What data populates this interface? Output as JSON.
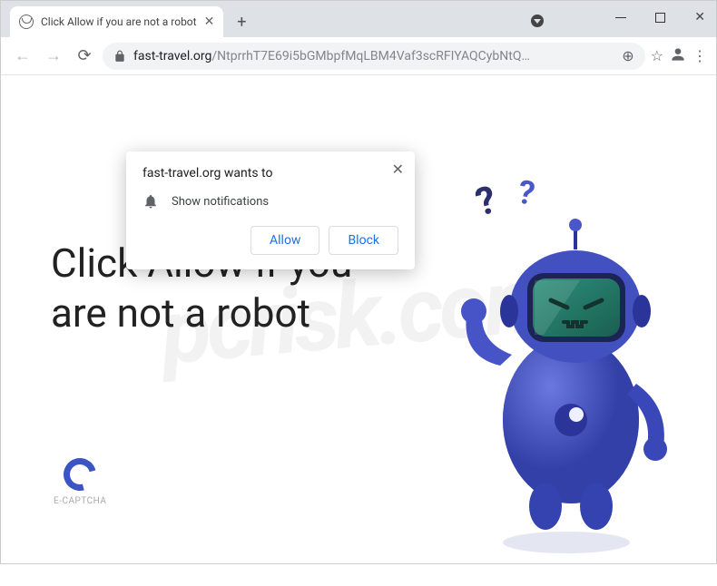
{
  "window": {
    "tab_title": "Click Allow if you are not a robot"
  },
  "addressbar": {
    "domain": "fast-travel.org",
    "path": "/NtprrhT7E69i5bGMbpfMqLBM4Vaf3scRFIYAQCybNtQ…"
  },
  "permission": {
    "title": "fast-travel.org wants to",
    "option": "Show notifications",
    "allow": "Allow",
    "block": "Block"
  },
  "page": {
    "headline": "Click Allow if you are not a robot",
    "captcha_label": "E-CAPTCHA",
    "watermark": "pcrisk.com"
  }
}
